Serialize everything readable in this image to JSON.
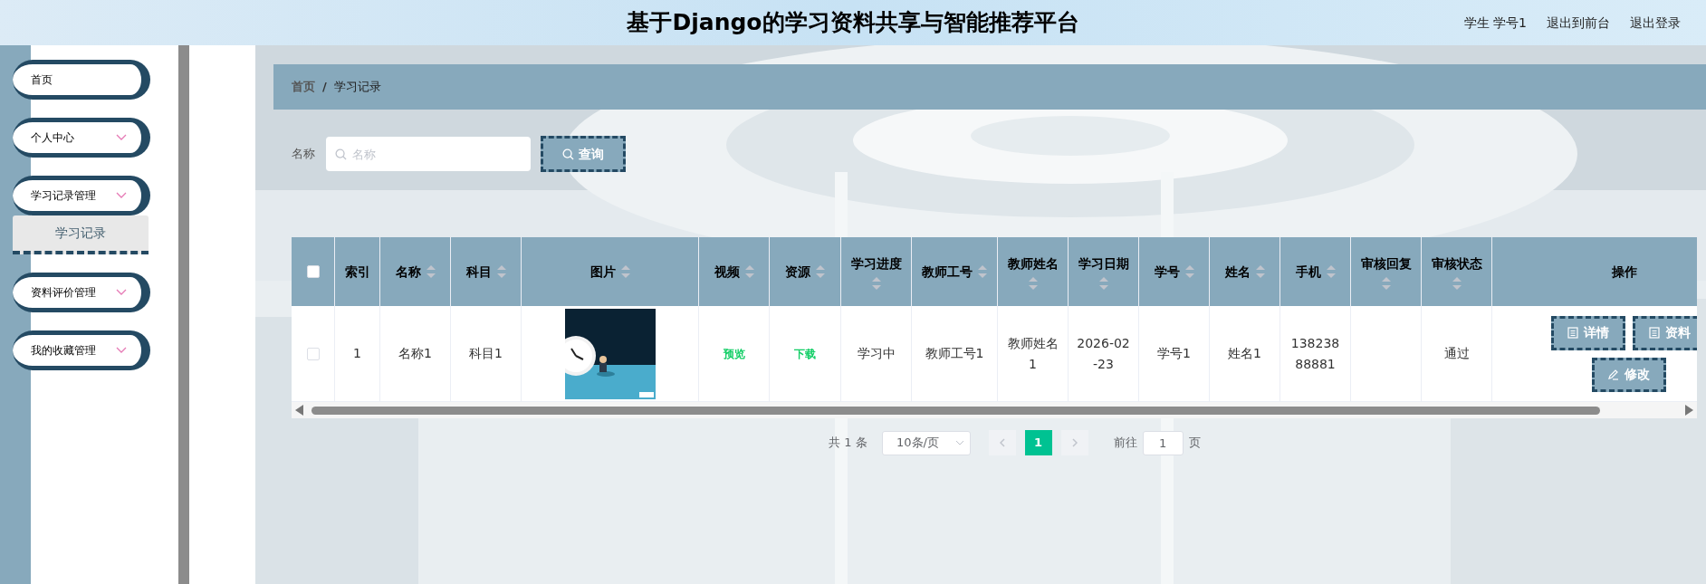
{
  "header": {
    "title": "基于Django的学习资料共享与智能推荐平台",
    "user": "学生 学号1",
    "links": [
      "退出到前台",
      "退出登录"
    ]
  },
  "sidebar": {
    "items": [
      {
        "label": "首页",
        "kind": "link"
      },
      {
        "label": "个人中心",
        "kind": "menu"
      },
      {
        "label": "学习记录管理",
        "kind": "menu",
        "children": [
          {
            "label": "学习记录",
            "selected": true
          }
        ]
      },
      {
        "label": "资料评价管理",
        "kind": "menu"
      },
      {
        "label": "我的收藏管理",
        "kind": "menu"
      }
    ]
  },
  "breadcrumb": {
    "items": [
      "首页",
      "学习记录"
    ],
    "separator": "/"
  },
  "search": {
    "label": "名称",
    "placeholder": "名称",
    "button": "查询"
  },
  "table": {
    "select_all": {
      "checked": false
    },
    "columns": [
      {
        "label": "索引",
        "sortable": false
      },
      {
        "label": "名称",
        "sortable": true
      },
      {
        "label": "科目",
        "sortable": true
      },
      {
        "label": "图片",
        "sortable": true
      },
      {
        "label": "视频",
        "sortable": true
      },
      {
        "label": "资源",
        "sortable": true
      },
      {
        "label": "学习进度",
        "sortable": true
      },
      {
        "label": "教师工号",
        "sortable": true
      },
      {
        "label": "教师姓名",
        "sortable": true
      },
      {
        "label": "学习日期",
        "sortable": true
      },
      {
        "label": "学号",
        "sortable": true
      },
      {
        "label": "姓名",
        "sortable": true
      },
      {
        "label": "手机",
        "sortable": true
      },
      {
        "label": "审核回复",
        "sortable": true
      },
      {
        "label": "审核状态",
        "sortable": true
      },
      {
        "label": "操作",
        "sortable": false
      }
    ],
    "rows": [
      {
        "checked": false,
        "cells": [
          {
            "kind": "text",
            "text": "1"
          },
          {
            "kind": "text",
            "text": "名称1"
          },
          {
            "kind": "text",
            "text": "科目1"
          },
          {
            "kind": "picture"
          },
          {
            "kind": "link",
            "text": "预览"
          },
          {
            "kind": "link",
            "text": "下载"
          },
          {
            "kind": "text",
            "text": "学习中"
          },
          {
            "kind": "text",
            "text": "教师工号1"
          },
          {
            "kind": "text",
            "text": "教师姓名1"
          },
          {
            "kind": "text",
            "text": "2026-02-23"
          },
          {
            "kind": "text",
            "text": "学号1"
          },
          {
            "kind": "text",
            "text": "姓名1"
          },
          {
            "kind": "text",
            "text": "13823888881"
          },
          {
            "kind": "blank"
          },
          {
            "kind": "text",
            "text": "通过"
          },
          {
            "kind": "actions",
            "buttons": [
              {
                "label": "详情",
                "kind": "view"
              },
              {
                "label": "资料",
                "kind": "view"
              },
              {
                "label": "修改",
                "kind": "edit"
              }
            ]
          }
        ]
      }
    ]
  },
  "pagination": {
    "total": "共 1 条",
    "page_size": "10条/页",
    "pages": [
      {
        "label": "1",
        "selected": true
      }
    ],
    "goto_label": "前往",
    "goto_value": "1",
    "goto_suffix": "页"
  }
}
